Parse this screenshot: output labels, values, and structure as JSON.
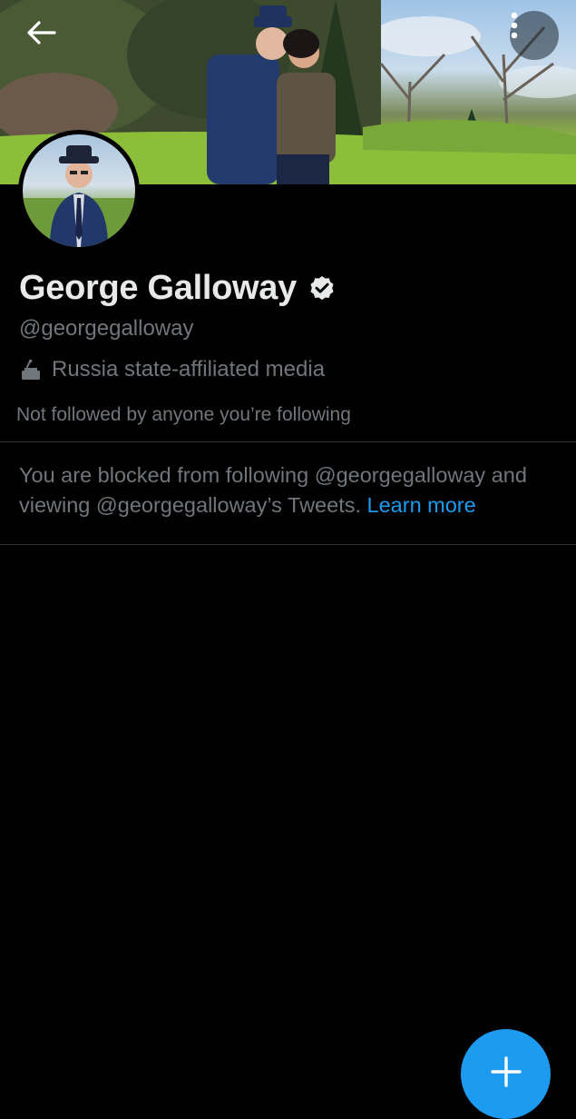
{
  "header": {
    "back_icon": "arrow-left-icon",
    "more_icon": "three-dots-vertical-icon"
  },
  "profile": {
    "display_name": "George Galloway",
    "verified_icon": "verified-badge-icon",
    "handle": "@georgegalloway",
    "label_icon": "state-media-podium-icon",
    "label": "Russia state-affiliated media",
    "followers_you_know": "Not followed by anyone you’re following"
  },
  "blocked_notice": {
    "text": "You are blocked from following @georgegalloway and viewing @georgegalloway’s Tweets.",
    "link": "Learn more"
  },
  "fab": {
    "icon": "plus-icon"
  },
  "colors": {
    "background": "#000000",
    "primary_text": "#e7e9ea",
    "secondary_text": "#71767b",
    "accent": "#1d9bf0",
    "divider": "#2f3336"
  }
}
